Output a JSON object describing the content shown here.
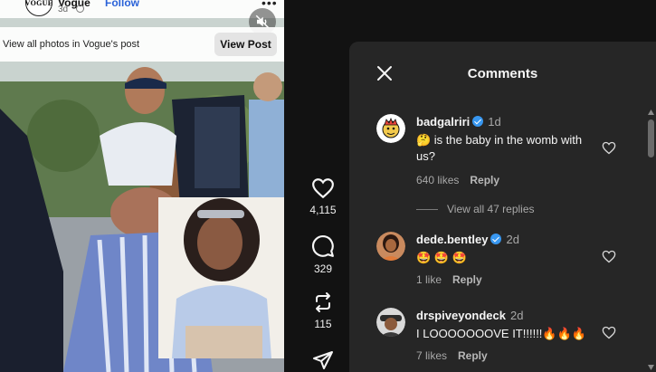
{
  "post": {
    "account": "Vogue",
    "follow_label": "Follow",
    "time": "3d",
    "avatar_text": "VOGUE",
    "more_label": "•••"
  },
  "banner": {
    "text": "View all photos in Vogue's post",
    "button_label": "View Post"
  },
  "actions": {
    "likes": "4,115",
    "comments": "329",
    "reposts": "115"
  },
  "comments_panel": {
    "title": "Comments",
    "comments": [
      {
        "username": "badgalriri",
        "verified": true,
        "time": "1d",
        "text": "🤔 is the baby in the womb with us?",
        "likes": "640 likes",
        "reply_label": "Reply",
        "view_replies": "View all 47 replies"
      },
      {
        "username": "dede.bentley",
        "verified": true,
        "time": "2d",
        "text": "🤩 🤩 🤩",
        "likes": "1 like",
        "reply_label": "Reply"
      },
      {
        "username": "drspiveyondeck",
        "verified": false,
        "time": "2d",
        "text": "I LOOOOOOOVE IT!!!!!!🔥🔥🔥",
        "likes": "7 likes",
        "reply_label": "Reply"
      }
    ]
  },
  "colors": {
    "background": "#121212",
    "panel": "#262626",
    "verified": "#3897f0",
    "link_blue": "#2a62d8"
  }
}
